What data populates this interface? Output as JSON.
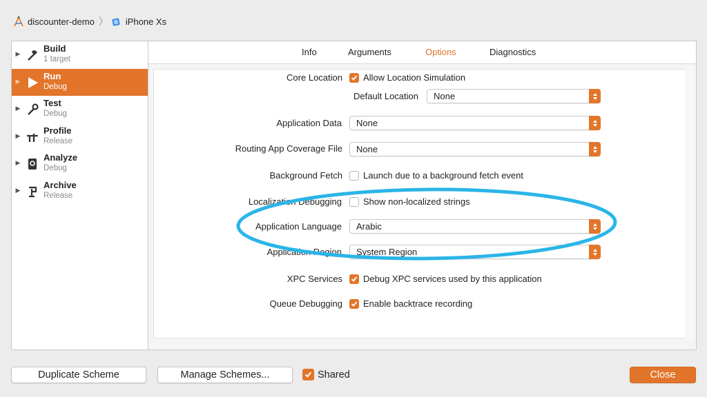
{
  "breadcrumb": {
    "project": "discounter-demo",
    "device": "iPhone Xs"
  },
  "sidebar": {
    "items": [
      {
        "name": "Build",
        "sub": "1 target",
        "icon": "hammer-icon"
      },
      {
        "name": "Run",
        "sub": "Debug",
        "icon": "play-icon"
      },
      {
        "name": "Test",
        "sub": "Debug",
        "icon": "wrench-icon"
      },
      {
        "name": "Profile",
        "sub": "Release",
        "icon": "instruments-icon"
      },
      {
        "name": "Analyze",
        "sub": "Debug",
        "icon": "analyze-icon"
      },
      {
        "name": "Archive",
        "sub": "Release",
        "icon": "archive-icon"
      }
    ]
  },
  "tabs": [
    "Info",
    "Arguments",
    "Options",
    "Diagnostics"
  ],
  "options": {
    "core_location": {
      "label": "Core Location",
      "checkbox": "Allow Location Simulation",
      "checked": true
    },
    "default_location": {
      "label": "Default Location",
      "value": "None"
    },
    "application_data": {
      "label": "Application Data",
      "value": "None"
    },
    "routing_coverage": {
      "label": "Routing App Coverage File",
      "value": "None"
    },
    "background_fetch": {
      "label": "Background Fetch",
      "checkbox": "Launch due to a background fetch event",
      "checked": false
    },
    "localization_debugging": {
      "label": "Localization Debugging",
      "checkbox": "Show non-localized strings",
      "checked": false
    },
    "application_language": {
      "label": "Application Language",
      "value": "Arabic"
    },
    "application_region": {
      "label": "Application Region",
      "value": "System Region"
    },
    "xpc_services": {
      "label": "XPC Services",
      "checkbox": "Debug XPC services used by this application",
      "checked": true
    },
    "queue_debugging": {
      "label": "Queue Debugging",
      "checkbox": "Enable backtrace recording",
      "checked": true
    }
  },
  "footer": {
    "duplicate": "Duplicate Scheme",
    "manage": "Manage Schemes...",
    "shared": "Shared",
    "shared_checked": true,
    "close": "Close"
  },
  "colors": {
    "accent": "#e2752a",
    "highlight_ring": "#2ab5e8"
  }
}
